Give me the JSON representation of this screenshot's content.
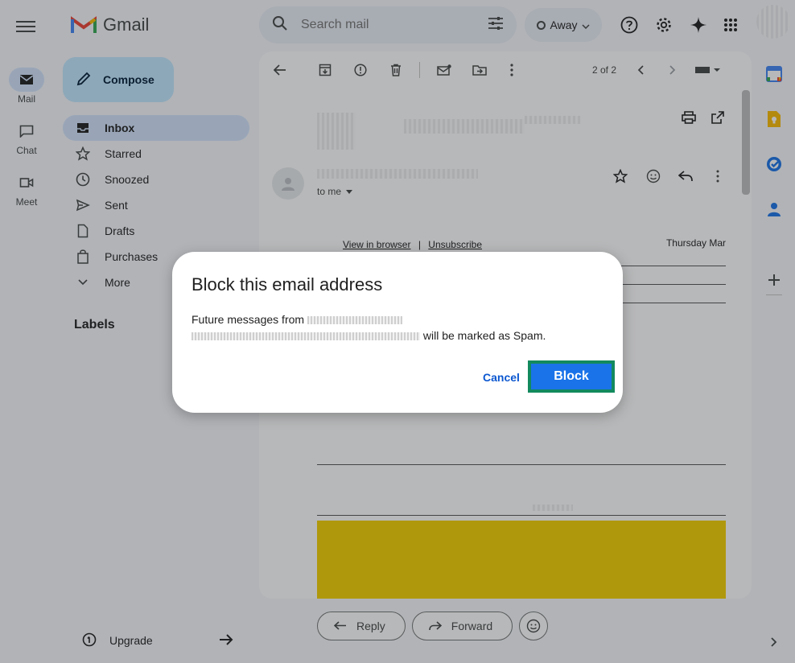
{
  "app": {
    "name": "Gmail"
  },
  "rail": {
    "items": [
      {
        "label": "Mail",
        "icon": "mail-icon"
      },
      {
        "label": "Chat",
        "icon": "chat-icon"
      },
      {
        "label": "Meet",
        "icon": "video-icon"
      }
    ]
  },
  "search": {
    "placeholder": "Search mail"
  },
  "status": {
    "label": "Away"
  },
  "sidebar": {
    "compose_label": "Compose",
    "items": [
      {
        "label": "Inbox",
        "icon": "inbox-icon",
        "active": true
      },
      {
        "label": "Starred",
        "icon": "star-icon"
      },
      {
        "label": "Snoozed",
        "icon": "clock-icon"
      },
      {
        "label": "Sent",
        "icon": "send-icon"
      },
      {
        "label": "Drafts",
        "icon": "draft-icon"
      },
      {
        "label": "Purchases",
        "icon": "bag-icon"
      },
      {
        "label": "More",
        "icon": "chevron-down-icon"
      }
    ],
    "labels_heading": "Labels",
    "upgrade_label": "Upgrade"
  },
  "toolbar": {
    "pager": "2 of 2"
  },
  "email": {
    "recipient": "to me",
    "view_in_browser": "View in browser",
    "separator": "|",
    "unsubscribe": "Unsubscribe",
    "date": "Thursday Mar"
  },
  "actions": {
    "reply": "Reply",
    "forward": "Forward"
  },
  "dialog": {
    "title": "Block this email address",
    "body_prefix": "Future messages from",
    "body_suffix": "will be marked as Spam.",
    "cancel": "Cancel",
    "block": "Block"
  },
  "colors": {
    "accent": "#1a73e8",
    "focus_ring": "#138a5e",
    "compose_bg": "#c2e7ff",
    "active_nav": "#d3e3fd"
  }
}
